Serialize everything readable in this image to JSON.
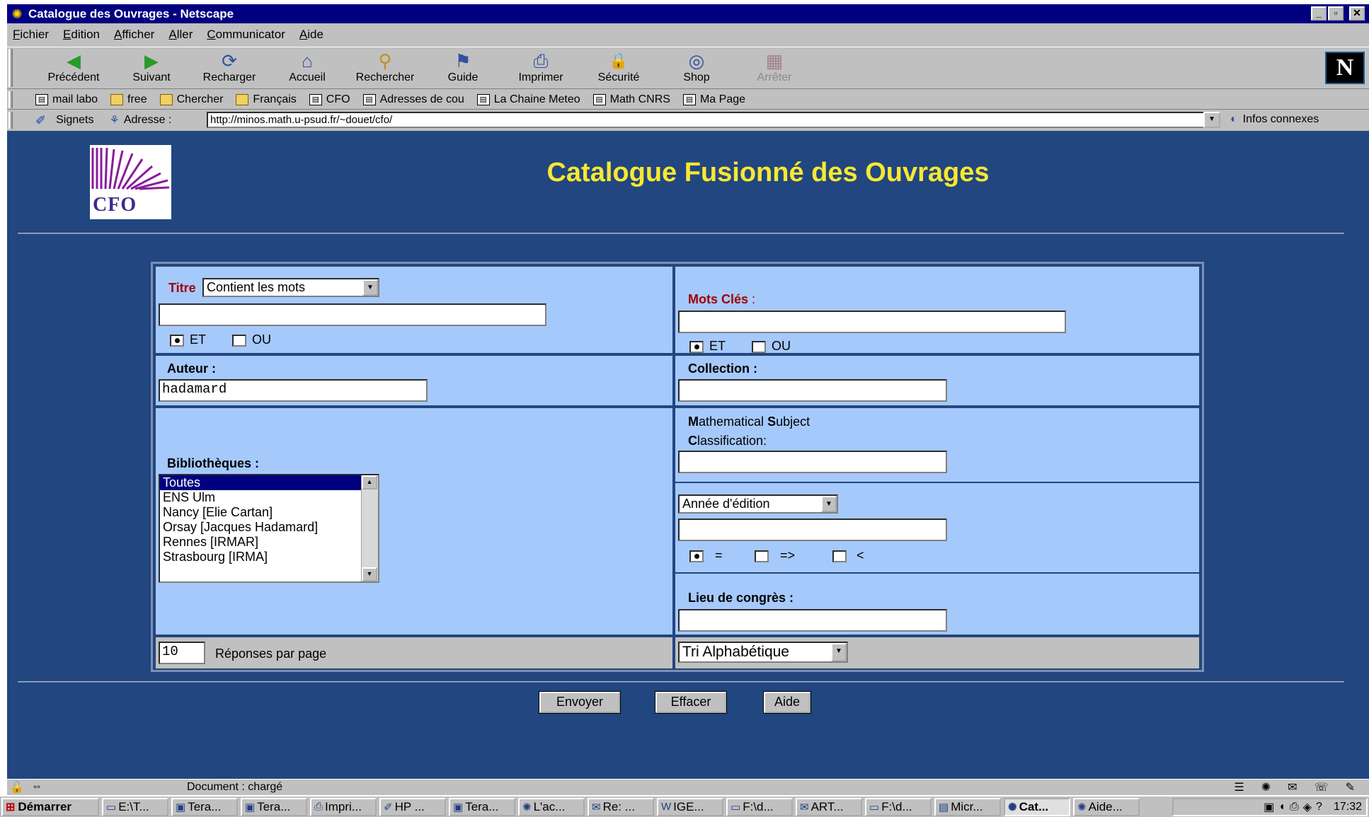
{
  "window": {
    "title": "Catalogue des Ouvrages - Netscape",
    "controls": [
      "_",
      "▫",
      "✕"
    ]
  },
  "menu": [
    "Fichier",
    "Edition",
    "Afficher",
    "Aller",
    "Communicator",
    "Aide"
  ],
  "toolbar": [
    {
      "label": "Précédent",
      "icon": "back-icon",
      "glyph": "◀"
    },
    {
      "label": "Suivant",
      "icon": "forward-icon",
      "glyph": "▶"
    },
    {
      "label": "Recharger",
      "icon": "reload-icon",
      "glyph": "⟳"
    },
    {
      "label": "Accueil",
      "icon": "home-icon",
      "glyph": "⌂"
    },
    {
      "label": "Rechercher",
      "icon": "search-icon",
      "glyph": "⚲"
    },
    {
      "label": "Guide",
      "icon": "guide-icon",
      "glyph": "⚑"
    },
    {
      "label": "Imprimer",
      "icon": "print-icon",
      "glyph": "⎙"
    },
    {
      "label": "Sécurité",
      "icon": "lock-icon",
      "glyph": "🔒"
    },
    {
      "label": "Shop",
      "icon": "shop-icon",
      "glyph": "◎"
    },
    {
      "label": "Arrêter",
      "icon": "stop-icon",
      "glyph": "▦",
      "disabled": true
    }
  ],
  "netscape_logo": "N",
  "bookmarks": [
    {
      "label": "mail labo",
      "type": "page"
    },
    {
      "label": "free",
      "type": "folder"
    },
    {
      "label": "Chercher",
      "type": "folder"
    },
    {
      "label": "Français",
      "type": "folder"
    },
    {
      "label": "CFO",
      "type": "page"
    },
    {
      "label": "Adresses de cou",
      "type": "page"
    },
    {
      "label": "La Chaine Meteo",
      "type": "page"
    },
    {
      "label": "Math CNRS",
      "type": "page"
    },
    {
      "label": "Ma Page",
      "type": "page"
    }
  ],
  "location": {
    "signets_label": "Signets",
    "address_label": "Adresse :",
    "url": "http://minos.math.u-psud.fr/~douet/cfo/",
    "infos_label": "Infos connexes"
  },
  "page": {
    "logo_text": "CFO",
    "title": "Catalogue Fusionné des Ouvrages",
    "titre": {
      "label": "Titre",
      "mode": "Contient les mots",
      "value": "",
      "radio_et": "ET",
      "radio_ou": "OU"
    },
    "mots_cles": {
      "label": "Mots Clés",
      "suffix": " :",
      "value": "",
      "radio_et": "ET",
      "radio_ou": "OU"
    },
    "auteur": {
      "label": "Auteur :",
      "value": "hadamard"
    },
    "collection": {
      "label": "Collection :",
      "value": ""
    },
    "bibliotheques": {
      "label": "Bibliothèques :",
      "items": [
        "Toutes",
        "ENS Ulm",
        "Nancy [Elie Cartan]",
        "Orsay [Jacques Hadamard]",
        "Rennes [IRMAR]",
        "Strasbourg [IRMA]"
      ],
      "selected": "Toutes"
    },
    "msc": {
      "line1_bold": "M",
      "line1_a": "athematical ",
      "line1_bold2": "S",
      "line1_b": "ubject",
      "line2_bold": "C",
      "line2_rest": "lassification:",
      "value": ""
    },
    "annee": {
      "select": "Année d'édition",
      "value": "",
      "op_eq": "=",
      "op_ge": "=>",
      "op_lt": "<"
    },
    "lieu": {
      "label": "Lieu de congrès :",
      "value": ""
    },
    "reponses": {
      "value": "10",
      "label": "Réponses par page"
    },
    "tri": {
      "select": "Tri Alphabétique"
    },
    "buttons": {
      "envoyer": "Envoyer",
      "effacer": "Effacer",
      "aide": "Aide"
    }
  },
  "status": {
    "text": "Document : chargé"
  },
  "taskbar": {
    "start": "Démarrer",
    "tasks": [
      "E:\\T...",
      "Tera...",
      "Tera...",
      "Impri...",
      "HP ...",
      "Tera...",
      "L'ac...",
      "Re: ...",
      "IGE...",
      "F:\\d...",
      "ART...",
      "F:\\d...",
      "Micr...",
      "Cat...",
      "Aide..."
    ],
    "active_task": "Cat...",
    "clock": "17:32"
  },
  "colors": {
    "page_bg": "#22467f",
    "form_bg": "#a6c9fb",
    "title_yellow": "#f7e832",
    "label_red": "#a00000",
    "titlebar": "#000080"
  }
}
